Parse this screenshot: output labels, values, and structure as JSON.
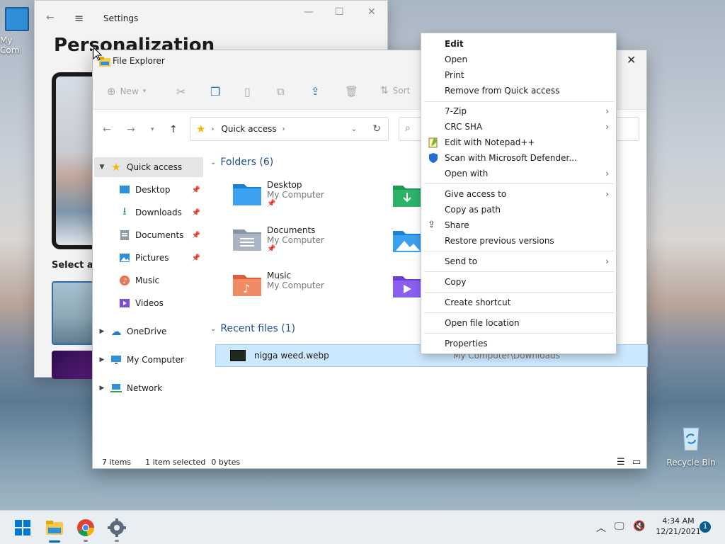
{
  "desktop": {
    "my_computer_label": "My Com",
    "recycle_bin_label": "Recycle Bin"
  },
  "settings": {
    "title": "Settings",
    "heading": "Personalization",
    "select_label": "Select a t"
  },
  "explorer": {
    "title": "File Explorer",
    "toolbar": {
      "new_label": "New",
      "sort_label": "Sort"
    },
    "address": {
      "location": "Quick access"
    },
    "nav": {
      "quick_access": "Quick access",
      "desktop": "Desktop",
      "downloads": "Downloads",
      "documents": "Documents",
      "pictures": "Pictures",
      "music": "Music",
      "videos": "Videos",
      "onedrive": "OneDrive",
      "my_computer": "My Computer",
      "network": "Network"
    },
    "folders_header": "Folders (6)",
    "folders": [
      {
        "name": "Desktop",
        "location": "My Computer"
      },
      {
        "name": "Documents",
        "location": "My Computer"
      },
      {
        "name": "Music",
        "location": "My Computer"
      }
    ],
    "recent_header": "Recent files (1)",
    "recent_files": [
      {
        "name": "nigga weed.webp",
        "location": "My Computer\\Downloads"
      }
    ],
    "status": {
      "items": "7 items",
      "selected": "1 item selected",
      "size": "0 bytes"
    }
  },
  "context_menu": {
    "items": [
      {
        "label": "Edit",
        "bold": true
      },
      {
        "label": "Open"
      },
      {
        "label": "Print"
      },
      {
        "label": "Remove from Quick access"
      },
      {
        "label": "7-Zip",
        "submenu": true
      },
      {
        "label": "CRC SHA",
        "submenu": true
      },
      {
        "label": "Edit with Notepad++"
      },
      {
        "label": "Scan with Microsoft Defender..."
      },
      {
        "label": "Open with",
        "submenu": true
      },
      {
        "label": "Give access to",
        "submenu": true
      },
      {
        "label": "Copy as path"
      },
      {
        "label": "Share"
      },
      {
        "label": "Restore previous versions"
      },
      {
        "label": "Send to",
        "submenu": true
      },
      {
        "label": "Copy"
      },
      {
        "label": "Create shortcut"
      },
      {
        "label": "Open file location"
      },
      {
        "label": "Properties"
      }
    ]
  },
  "taskbar": {
    "time": "4:34 AM",
    "date": "12/21/2021",
    "notification_count": "1"
  },
  "colors": {
    "accent": "#0067c0",
    "folder_blue": "#2f8fd8",
    "selection": "#cce8ff"
  }
}
